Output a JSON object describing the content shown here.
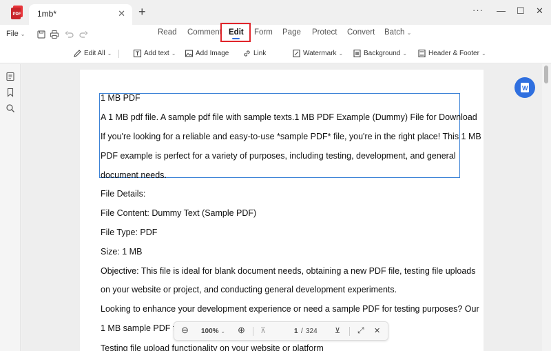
{
  "tab": {
    "title": "1mb*",
    "close": "✕",
    "new_tab": "+"
  },
  "window_controls": {
    "more": "···",
    "minimize": "—",
    "maximize": "☐",
    "close": "✕"
  },
  "menu": {
    "file": "File",
    "file_caret": "⌄",
    "tabs": [
      "Read",
      "Comment",
      "Edit",
      "Form",
      "Page",
      "Protect",
      "Convert",
      "Batch"
    ],
    "batch_caret": "⌄",
    "active_tab": "Edit"
  },
  "toolbar": {
    "edit_all": "Edit All",
    "add_text": "Add text",
    "add_image": "Add Image",
    "link": "Link",
    "watermark": "Watermark",
    "background": "Background",
    "header_footer": "Header & Footer",
    "caret": "⌄"
  },
  "document": {
    "lines": [
      "1 MB PDF",
      "A 1 MB pdf file. A sample pdf file with sample texts.1 MB PDF Example (Dummy) File for Download",
      "If you're looking for a reliable and easy-to-use *sample PDF* file, you're in the right place! This 1 MB",
      "PDF example is perfect for a variety of purposes, including testing, development, and general",
      "document needs.",
      "File Details:",
      "File Content: Dummy Text (Sample PDF)",
      "File Type: PDF",
      "Size: 1 MB",
      "Objective: This file is ideal for blank document needs, obtaining a new PDF file, testing file uploads",
      "on your website or project, and conducting general development experiments.",
      "Looking to enhance your development experience or need a sample PDF for testing purposes? Our",
      "1 MB sample PDF fi",
      "Testing file upload functionality on your website or platform"
    ]
  },
  "zoom": {
    "zoom_out": "⊖",
    "level": "100%",
    "zoom_caret": "⌄",
    "zoom_in": "⊕",
    "prev_page": "⊼",
    "current_page": "1",
    "page_sep": "/",
    "total_pages": "324",
    "next_page": "⊻",
    "fit": "⤢",
    "close": "✕"
  },
  "colors": {
    "accent": "#2f6fdf",
    "highlight": "#e0242a",
    "selection": "#3b82d6"
  }
}
